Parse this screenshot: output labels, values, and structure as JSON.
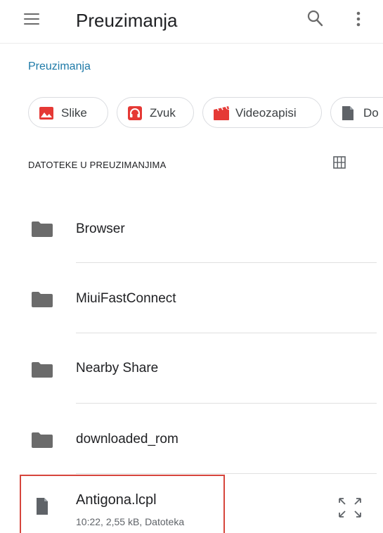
{
  "appbar": {
    "title": "Preuzimanja",
    "icons": {
      "menu": "menu-icon",
      "search": "search-icon",
      "more": "more-vert-icon"
    }
  },
  "breadcrumb": "Preuzimanja",
  "chips": [
    {
      "label": "Slike",
      "icon": "image-icon",
      "color": "#e53935"
    },
    {
      "label": "Zvuk",
      "icon": "headphones-icon",
      "color": "#e53935"
    },
    {
      "label": "Videozapisi",
      "icon": "movie-icon",
      "color": "#e53935"
    },
    {
      "label": "Do",
      "icon": "document-icon",
      "color": "#5f6368"
    }
  ],
  "section": {
    "heading": "DATOTEKE U PREUZIMANJIMA",
    "view_icon": "grid-view-icon"
  },
  "folders": [
    {
      "name": "Browser"
    },
    {
      "name": "MiuiFastConnect"
    },
    {
      "name": "Nearby Share"
    },
    {
      "name": "downloaded_rom"
    }
  ],
  "file": {
    "name": "Antigona.lcpl",
    "meta": "10:22, 2,55 kB, Datoteka",
    "highlight_color": "#d6453c"
  },
  "colors": {
    "accent": "#1e7aa8",
    "icon_gray": "#6b6b6b"
  }
}
